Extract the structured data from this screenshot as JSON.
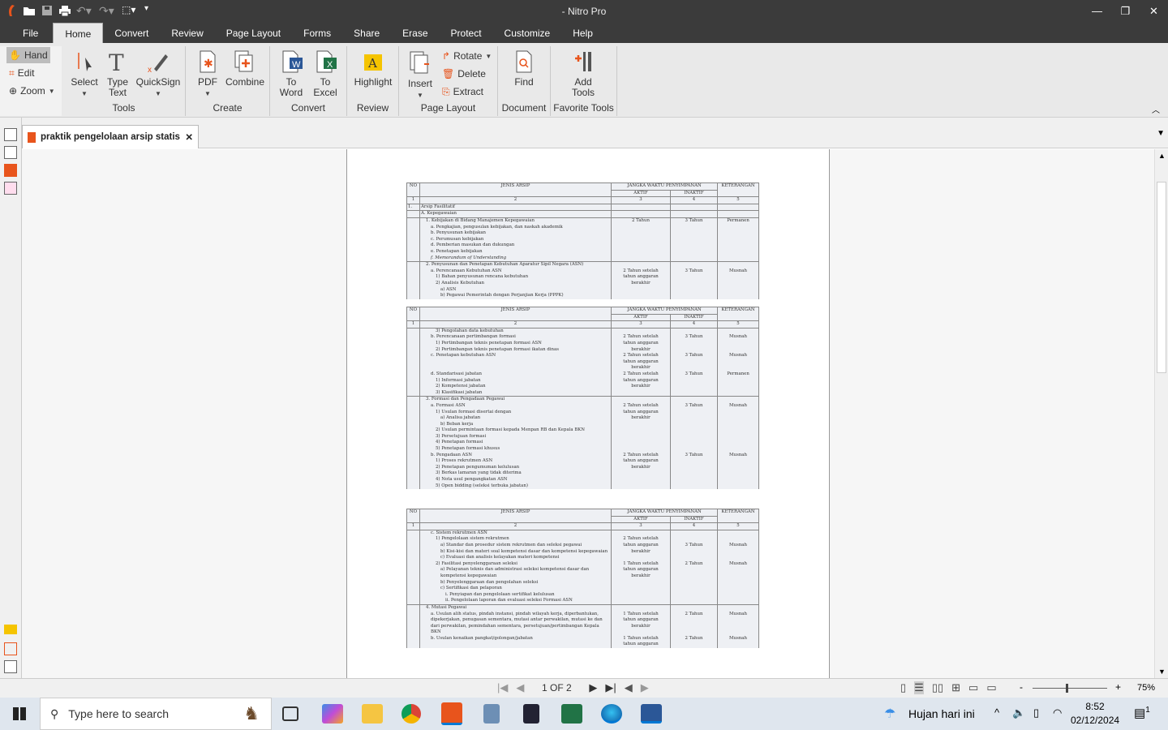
{
  "app": {
    "title": "- Nitro Pro",
    "brand_color": "#e8541c"
  },
  "menu_tabs": [
    "File",
    "Home",
    "Convert",
    "Review",
    "Page Layout",
    "Forms",
    "Share",
    "Erase",
    "Protect",
    "Customize",
    "Help"
  ],
  "ribbon": {
    "nav": {
      "hand": "Hand",
      "edit": "Edit",
      "zoom": "Zoom"
    },
    "tools": {
      "label": "Tools",
      "select": "Select",
      "type_text_1": "Type",
      "type_text_2": "Text",
      "quicksign": "QuickSign"
    },
    "create": {
      "label": "Create",
      "pdf": "PDF",
      "combine": "Combine"
    },
    "convert": {
      "label": "Convert",
      "to_word_1": "To",
      "to_word_2": "Word",
      "to_excel_1": "To",
      "to_excel_2": "Excel"
    },
    "review": {
      "label": "Review",
      "highlight": "Highlight"
    },
    "page_layout": {
      "label": "Page Layout",
      "insert": "Insert",
      "rotate": "Rotate",
      "delete": "Delete",
      "extract": "Extract"
    },
    "document": {
      "label": "Document",
      "find": "Find"
    },
    "favorite": {
      "label": "Favorite Tools",
      "add_1": "Add",
      "add_2": "Tools"
    }
  },
  "document_tab": {
    "name": "praktik pengelolaan arsip statis"
  },
  "table_header": {
    "no": "NO",
    "jenis": "JENIS ARSIP",
    "jangka": "JANGKA WAKTU PENYIMPANAN",
    "aktif": "AKTIF",
    "inaktif": "INAKTIF",
    "ket": "KETERANGAN",
    "n1": "1",
    "n2": "2",
    "n3": "3",
    "n4": "4",
    "n5": "5"
  },
  "tables": [
    {
      "groups": [
        {
          "no": "1.",
          "segs": [
            {
              "lines": [
                {
                  "i": 0,
                  "t": "Arsip Fasilitatif"
                }
              ],
              "aktif": "",
              "inaktif": "",
              "ket": ""
            }
          ]
        },
        {
          "no": "",
          "segs": [
            {
              "lines": [
                {
                  "i": 0,
                  "t": "A.   Kepegawaian"
                }
              ],
              "aktif": "",
              "inaktif": "",
              "ket": ""
            }
          ]
        },
        {
          "no": "",
          "segs": [
            {
              "lines": [
                {
                  "i": 1,
                  "t": "1.  Kebijakan di Bidang Manajemen Kepegawaian"
                },
                {
                  "i": 2,
                  "t": "a. Pengkajian, pengusulan kebijakan, dan naskah akademik"
                },
                {
                  "i": 2,
                  "t": "b. Penyusunan kebijakan"
                },
                {
                  "i": 2,
                  "t": "c. Perumusan kebijakan"
                },
                {
                  "i": 2,
                  "t": "d. Pemberian masukan dan dukungan"
                },
                {
                  "i": 2,
                  "t": "e. Penetapan kebijakan"
                },
                {
                  "i": 2,
                  "t": "f.  Memorandum of Understanding",
                  "it": true
                }
              ],
              "aktif": "2 Tahun",
              "inaktif": "3 Tahun",
              "ket": "Permanen"
            }
          ]
        },
        {
          "no": "",
          "segs": [
            {
              "lines": [
                {
                  "i": 1,
                  "t": "2.  Penyusunan dan Penetapan Kebutuhan Aparatur Sipil Negara (ASN)"
                },
                {
                  "i": 2,
                  "t": "a. Perencanaan Kebutuhan ASN"
                },
                {
                  "i": 3,
                  "t": "1) Bahan penyusunan rencana kebutuhan"
                },
                {
                  "i": 3,
                  "t": "2) Analisis Kebutuhan"
                },
                {
                  "i": 4,
                  "t": "a) ASN"
                },
                {
                  "i": 4,
                  "t": "b) Pegawai Pemerintah dengan Perjanjian Kerja (PPPK)"
                }
              ],
              "aktif": "\n2 Tahun setelah\ntahun anggaran\nberakhir",
              "inaktif": "\n3 Tahun",
              "ket": "\nMusnah"
            }
          ]
        }
      ]
    },
    {
      "groups": [
        {
          "no": "",
          "segs": [
            {
              "lines": [
                {
                  "i": 3,
                  "t": "3) Pengolahan data kebutuhan"
                }
              ],
              "aktif": "",
              "inaktif": "",
              "ket": ""
            },
            {
              "lines": [
                {
                  "i": 2,
                  "t": "b. Perencanaan pertimbangan formasi"
                },
                {
                  "i": 3,
                  "t": "1) Pertimbangan teknis penetapan formasi ASN"
                },
                {
                  "i": 3,
                  "t": "2) Pertimbangan teknis penetapan formasi ikatan dinas"
                }
              ],
              "aktif": "2 Tahun setelah\ntahun anggaran\nberakhir",
              "inaktif": "3 Tahun",
              "ket": "Musnah"
            },
            {
              "lines": [
                {
                  "i": 2,
                  "t": "c. Penetapan kebutuhan ASN"
                },
                {
                  "i": 2,
                  "t": " "
                },
                {
                  "i": 2,
                  "t": " "
                }
              ],
              "aktif": "2 Tahun setelah\ntahun anggaran\nberakhir",
              "inaktif": "3 Tahun",
              "ket": "Musnah"
            },
            {
              "lines": [
                {
                  "i": 2,
                  "t": "d. Standarisasi jabatan"
                },
                {
                  "i": 3,
                  "t": "1) Informasi jabatan"
                },
                {
                  "i": 3,
                  "t": "2) Kompetensi jabatan"
                },
                {
                  "i": 3,
                  "t": "3) Klasifikasi jabatan"
                }
              ],
              "aktif": "2 Tahun setelah\ntahun anggaran\nberakhir",
              "inaktif": "3 Tahun",
              "ket": "Permanen"
            }
          ]
        },
        {
          "no": "",
          "segs": [
            {
              "lines": [
                {
                  "i": 1,
                  "t": "3.  Formasi dan Pengadaan Pegawai"
                },
                {
                  "i": 2,
                  "t": "a. Formasi ASN"
                },
                {
                  "i": 3,
                  "t": "1) Usulan formasi disertai dengan"
                },
                {
                  "i": 4,
                  "t": "a) Analisa jabatan"
                },
                {
                  "i": 4,
                  "t": "b) Beban kerja"
                },
                {
                  "i": 3,
                  "t": "2) Usulan permintaan formasi kepada Menpan RB dan Kepala BKN"
                },
                {
                  "i": 3,
                  "t": "3) Persetujuan formasi"
                },
                {
                  "i": 3,
                  "t": "4) Penetapan formasi"
                },
                {
                  "i": 3,
                  "t": "5) Penetapan formasi khusus"
                }
              ],
              "aktif": "\n2 Tahun setelah\ntahun anggaran\nberakhir",
              "inaktif": "\n3 Tahun",
              "ket": "\nMusnah"
            },
            {
              "lines": [
                {
                  "i": 2,
                  "t": "b. Pengadaan ASN"
                },
                {
                  "i": 3,
                  "t": "1) Proses rekrutmen ASN"
                },
                {
                  "i": 3,
                  "t": "2) Penetapan pengumuman kelulusan"
                },
                {
                  "i": 3,
                  "t": "3) Berkas lamaran yang tidak diterima"
                },
                {
                  "i": 3,
                  "t": "4) Nota usul pengangkatan ASN"
                },
                {
                  "i": 3,
                  "t": "5) Open bidding (seleksi terbuka jabatan)"
                }
              ],
              "aktif": "2 Tahun setelah\ntahun anggaran\nberakhir",
              "inaktif": "3 Tahun",
              "ket": "Musnah"
            }
          ]
        }
      ]
    },
    {
      "groups": [
        {
          "no": "",
          "segs": [
            {
              "lines": [
                {
                  "i": 2,
                  "t": "c. Sistem rekrutmen ASN"
                },
                {
                  "i": 3,
                  "t": "1) Pengelolaan sistem rekrutmen"
                },
                {
                  "i": 4,
                  "t": "a) Standar dan prosedur sistem rekrutmen dan seleksi pegawai"
                },
                {
                  "i": 4,
                  "t": "b) Kisi-kisi dan materi soal kompetensi dasar dan kompetensi kepegawaian"
                },
                {
                  "i": 4,
                  "t": "c) Evaluasi dan analisis kelayakan materi kompetensi"
                }
              ],
              "aktif": "\n2 Tahun setelah\ntahun anggaran\nberakhir",
              "inaktif": "\n\n3 Tahun",
              "ket": "\n\nMusnah"
            },
            {
              "lines": [
                {
                  "i": 3,
                  "t": "2) Fasilitasi penyelenggaraan seleksi"
                },
                {
                  "i": 4,
                  "t": "a) Pelayanan teknis dan administrasi seleksi kompetensi dasar dan kompetensi kepegawaian"
                },
                {
                  "i": 4,
                  "t": "b) Penyelenggaraan dan pengolahan seleksi"
                },
                {
                  "i": 4,
                  "t": "c) Sertifikasi dan pelaporan"
                },
                {
                  "i": 5,
                  "t": "i.  Penyiapan dan pengelolaan sertifikat kelulusan"
                },
                {
                  "i": 5,
                  "t": "ii. Pengelolaan laporan dan evaluasi seleksi Formasi ASN"
                }
              ],
              "aktif": "1 Tahun setelah\ntahun anggaran\nberakhir",
              "inaktif": "2 Tahun",
              "ket": "Musnah"
            }
          ]
        },
        {
          "no": "",
          "segs": [
            {
              "lines": [
                {
                  "i": 1,
                  "t": "4.  Mutasi Pegawai"
                },
                {
                  "i": 2,
                  "t": "a. Usulan alih status, pindah instansi, pindah wilayah kerja, diperbantukan, dipekerjakan, penugasan sementara, mutasi antar perwakilan, mutasi ke dan dari perwakilan, pemindahan sementara, persetujuan/pertimbangan Kepala BKN"
                }
              ],
              "aktif": "\n1 Tahun setelah\ntahun anggaran\nberakhir",
              "inaktif": "\n2 Tahun",
              "ket": "\nMusnah"
            },
            {
              "lines": [
                {
                  "i": 2,
                  "t": "b. Usulan kenaikan pangkat/golongan/jabatan"
                }
              ],
              "aktif": "1 Tahun setelah\ntahun anggaran",
              "inaktif": "2 Tahun",
              "ket": "Musnah"
            }
          ]
        }
      ]
    }
  ],
  "status": {
    "page": "1 OF 2",
    "zoom": "75%",
    "zoom_fraction": 0.45
  },
  "taskbar": {
    "search_placeholder": "Type here to search",
    "weather": "Hujan hari ini",
    "time": "8:52",
    "date": "02/12/2024",
    "notifications": "1"
  }
}
